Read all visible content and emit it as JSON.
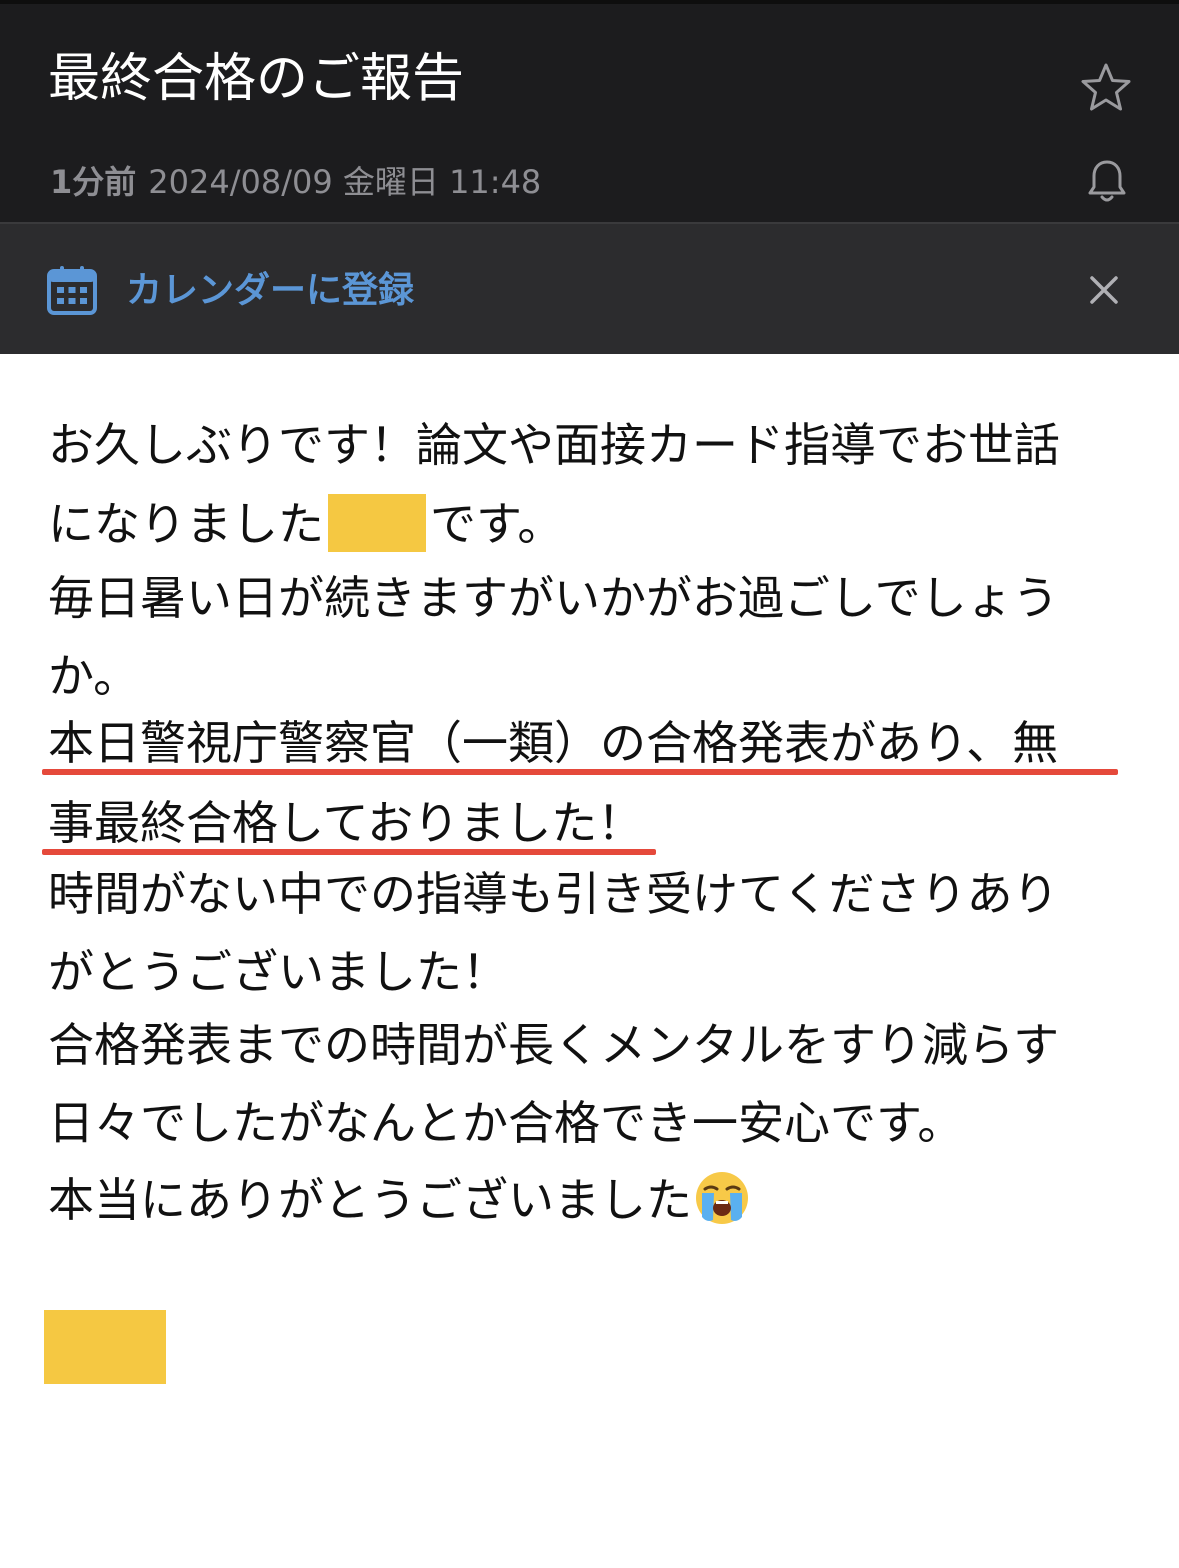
{
  "header": {
    "subject": "最終合格のご報告",
    "relative_time": "1分前",
    "datetime": "2024/08/09 金曜日 11:48",
    "star_icon": "star-icon",
    "bell_icon": "bell-icon"
  },
  "calendar_bar": {
    "icon": "calendar-icon",
    "label": "カレンダーに登録",
    "close_icon": "close-icon",
    "accent_color": "#5b96d6"
  },
  "message": {
    "lines": [
      "お久しぶりです！論文や面接カード指導でお世話",
      "になりました",
      "です。",
      "毎日暑い日が続きますがいかがお過ごしでしょう",
      "か。",
      "本日警視庁警察官（一類）の合格発表があり、無",
      "事最終合格しておりました！",
      "時間がない中での指導も引き受けてくださりあり",
      "がとうございました！",
      "合格発表までの時間が長くメンタルをすり減らす",
      "日々でしたがなんとか合格でき一安心です。",
      "本当にありがとうございました"
    ],
    "emoji": "loudly-crying-face-emoji",
    "redaction_color": "#f5c842",
    "underline_color": "#e5493b"
  }
}
